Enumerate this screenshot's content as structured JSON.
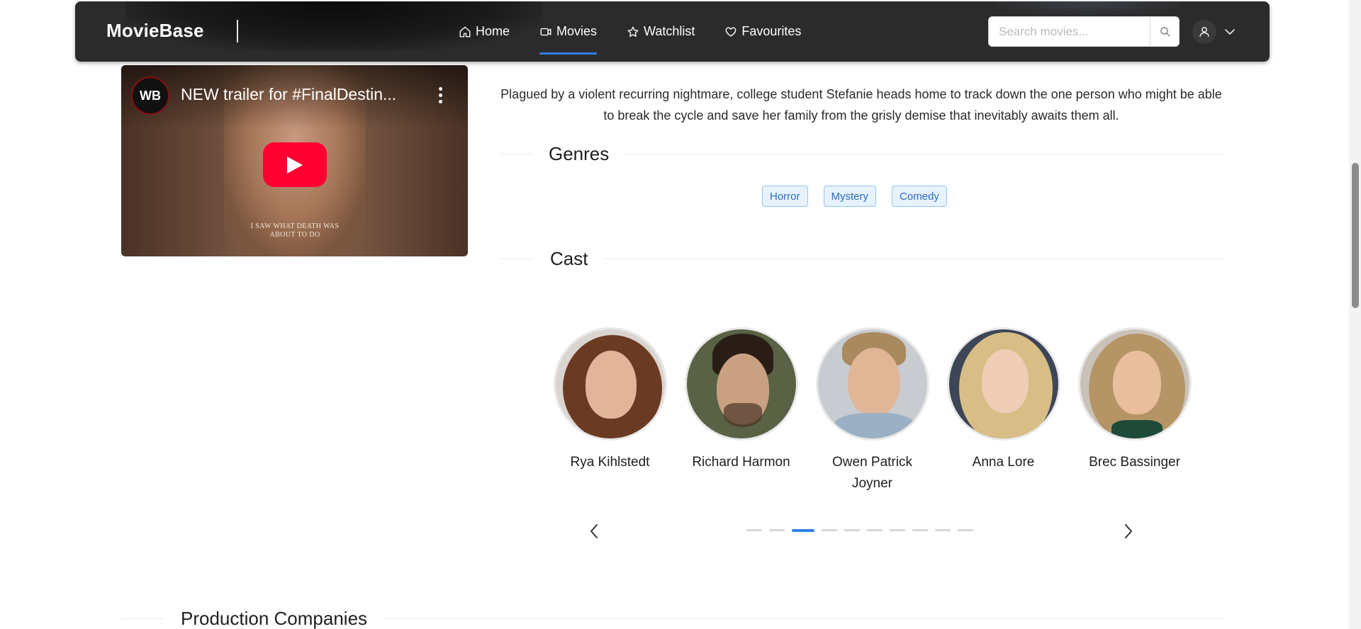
{
  "navbar": {
    "brand": "MovieBase",
    "links": [
      {
        "label": "Home",
        "icon": "home-icon",
        "active": false
      },
      {
        "label": "Movies",
        "icon": "video-icon",
        "active": true
      },
      {
        "label": "Watchlist",
        "icon": "star-icon",
        "active": false
      },
      {
        "label": "Favourites",
        "icon": "heart-icon",
        "active": false
      }
    ],
    "search_placeholder": "Search movies...",
    "accent_color": "#2f7fe6"
  },
  "video": {
    "title": "NEW trailer for #FinalDestin...",
    "channel_logo": "WB",
    "caption": "I SAW WHAT DEATH WAS ABOUT TO DO"
  },
  "overview": "Plagued by a violent recurring nightmare, college student Stefanie heads home to track down the one person who might be able to break the cycle and save her family from the grisly demise that inevitably awaits them all.",
  "genres": {
    "heading": "Genres",
    "items": [
      "Horror",
      "Mystery",
      "Comedy"
    ]
  },
  "cast": {
    "heading": "Cast",
    "members": [
      {
        "name": "Rya Kihlstedt"
      },
      {
        "name": "Richard Harmon"
      },
      {
        "name": "Owen Patrick Joyner"
      },
      {
        "name": "Anna Lore"
      },
      {
        "name": "Brec Bassinger"
      }
    ],
    "carousel": {
      "page_count": 10,
      "active_page": 3
    }
  },
  "production": {
    "heading": "Production Companies"
  }
}
